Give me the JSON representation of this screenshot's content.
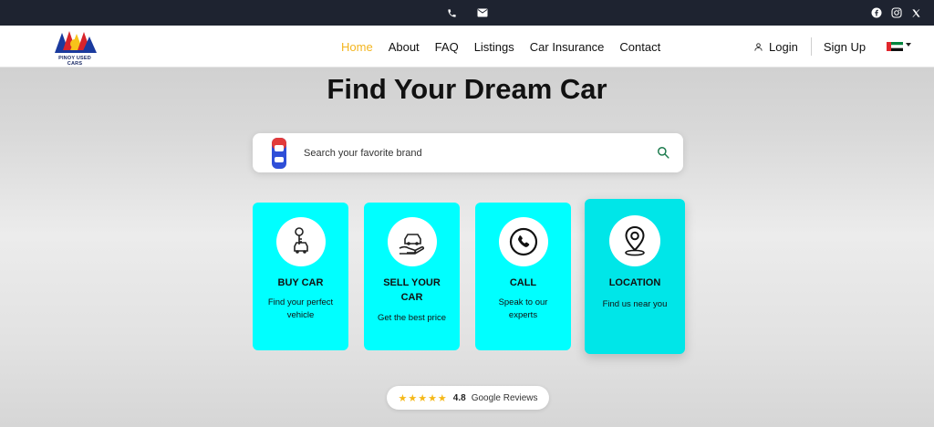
{
  "nav": {
    "logo_text": "PINOY USED CARS",
    "links": [
      "Home",
      "About",
      "FAQ",
      "Listings",
      "Car Insurance",
      "Contact"
    ],
    "login": "Login",
    "signup": "Sign Up"
  },
  "hero": {
    "title": "Find Your Dream Car",
    "search_placeholder": "Search your favorite brand"
  },
  "cards": [
    {
      "title": "BUY CAR",
      "desc": "Find your perfect vehicle",
      "icon": "car-key-icon"
    },
    {
      "title": "SELL YOUR CAR",
      "desc": "Get the best price",
      "icon": "car-in-hand-icon"
    },
    {
      "title": "CALL",
      "desc": "Speak to our experts",
      "icon": "phone-icon"
    },
    {
      "title": "LOCATION",
      "desc": "Find us near you",
      "icon": "location-pin-icon"
    }
  ],
  "reviews": {
    "stars": "★★★★★",
    "rating": "4.8",
    "label": "Google Reviews"
  },
  "colors": {
    "topbar": "#1e2330",
    "accent": "#f3b51f",
    "card": "#00ffff",
    "card_highlight": "#00e6e8",
    "star": "#f5b819"
  }
}
